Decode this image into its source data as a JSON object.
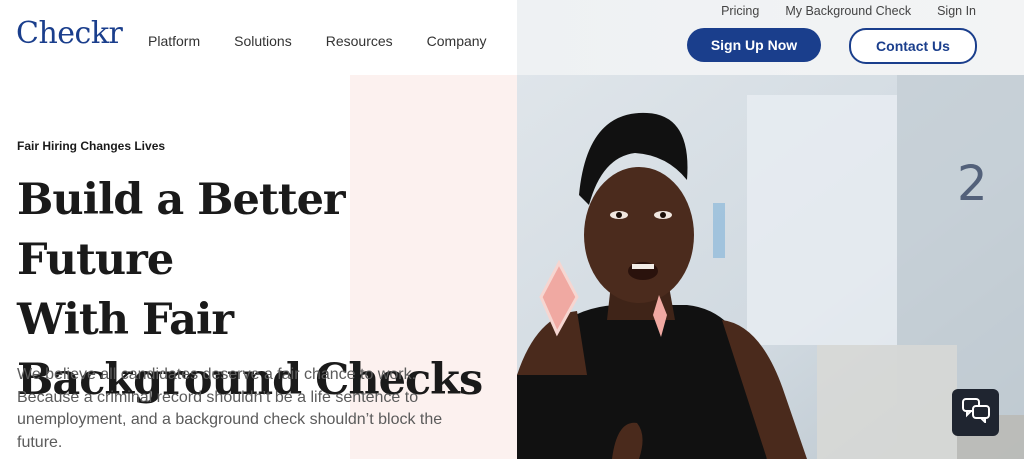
{
  "brand": {
    "logo_text": "Checkr",
    "color_primary": "#1a3e8c"
  },
  "nav": {
    "items": [
      "Platform",
      "Solutions",
      "Resources",
      "Company"
    ]
  },
  "utility_nav": {
    "items": [
      "Pricing",
      "My Background Check",
      "Sign In"
    ]
  },
  "cta": {
    "signup_label": "Sign Up Now",
    "contact_label": "Contact Us"
  },
  "hero": {
    "eyebrow": "Fair Hiring Changes Lives",
    "headline_lines": [
      "Build a Better Future",
      "With Fair",
      "Background Checks"
    ],
    "body": "We believe all candidates deserve a fair chance to work. Because a criminal record shouldn’t be a life sentence to unemployment, and a background check shouldn’t block the future."
  },
  "chat_widget": {
    "icon": "chat-bubbles-icon"
  }
}
